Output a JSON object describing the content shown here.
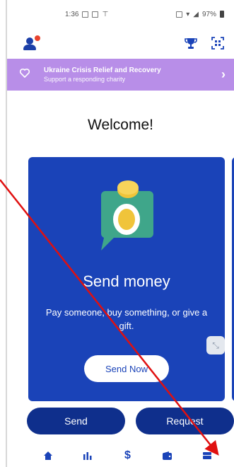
{
  "status_bar": {
    "time": "1:36",
    "battery": "97%"
  },
  "banner": {
    "title": "Ukraine Crisis Relief and Recovery",
    "subtitle": "Support a responding charity",
    "chevron": "›",
    "icon": "heart-icon",
    "color": "#b88ee8"
  },
  "welcome": "Welcome!",
  "card": {
    "title": "Send money",
    "description": "Pay someone, buy something, or give a gift.",
    "button": "Send Now",
    "color": "#1a43b8"
  },
  "actions": {
    "send": "Send",
    "request": "Request"
  },
  "nav": {
    "items": [
      {
        "icon": "home-icon"
      },
      {
        "icon": "activity-chart-icon"
      },
      {
        "icon": "dollar-icon",
        "glyph": "$"
      },
      {
        "icon": "wallet-icon"
      },
      {
        "icon": "menu-icon"
      }
    ]
  },
  "colors": {
    "primary": "#1a43b8",
    "button_dark": "#0f2f8c",
    "alert_dot": "#e8432e",
    "arrow": "#e01010"
  }
}
